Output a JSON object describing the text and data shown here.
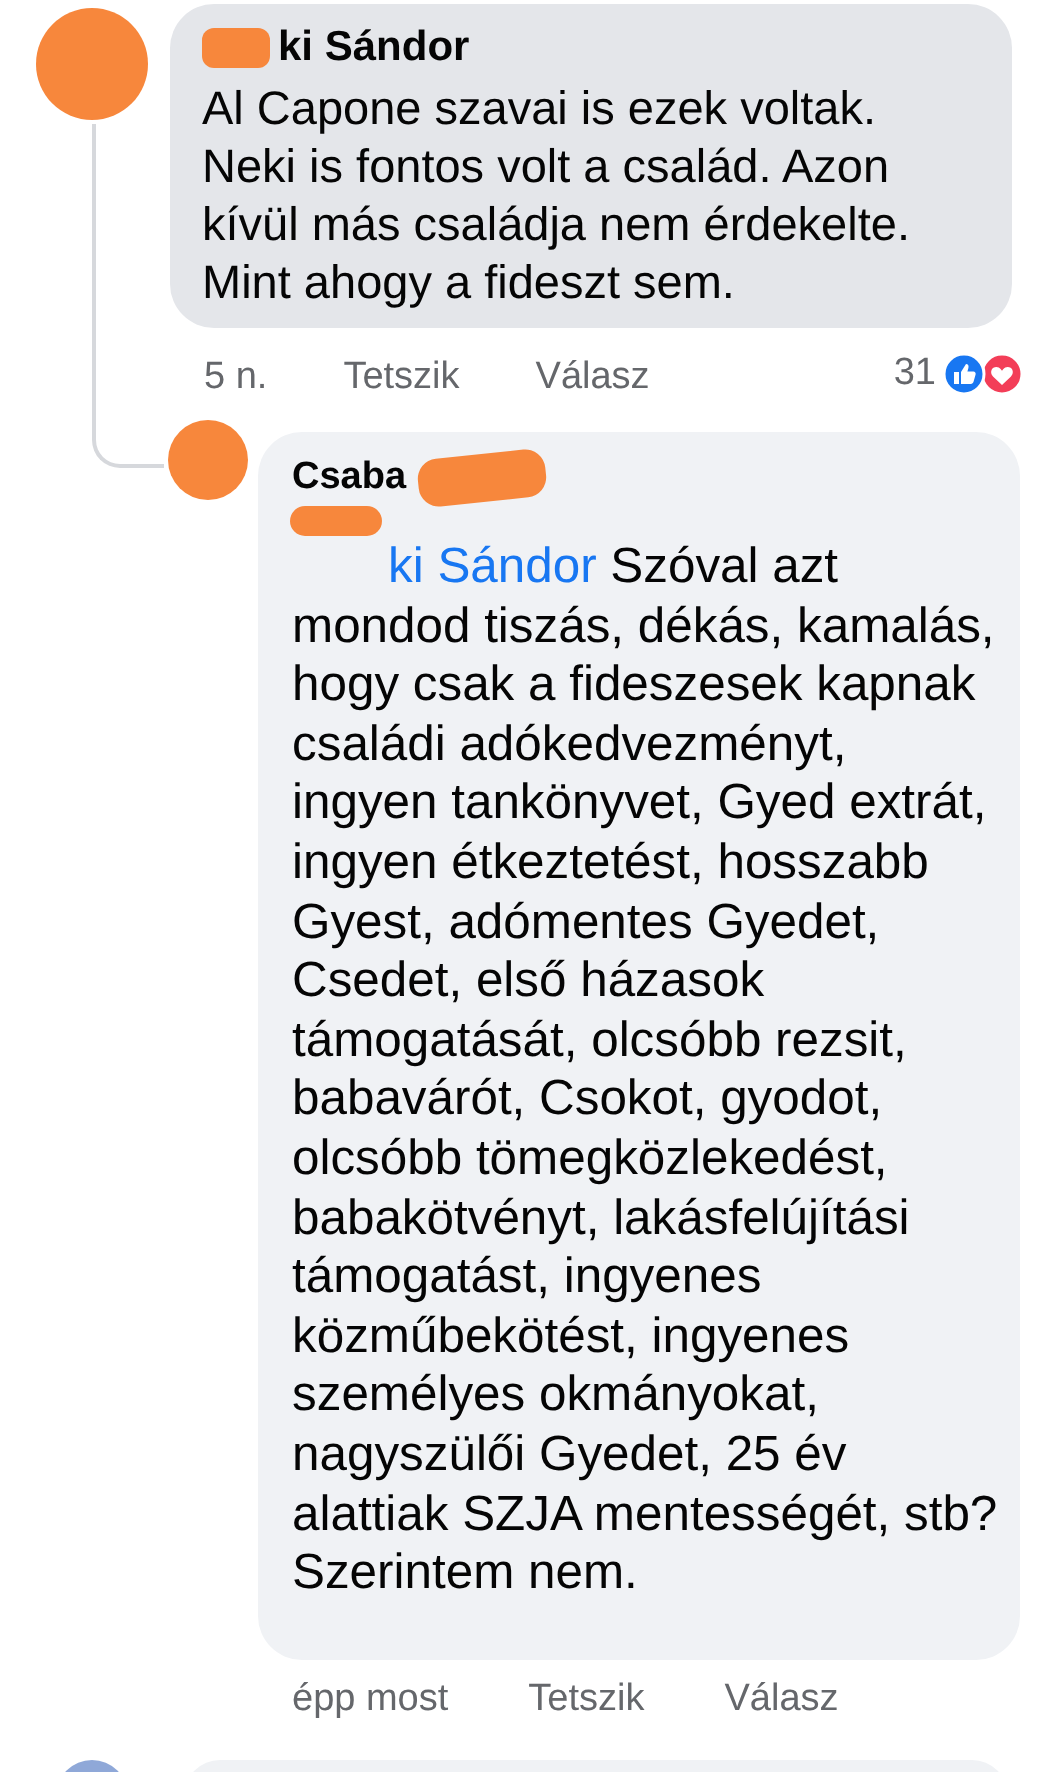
{
  "comments": [
    {
      "author": "ki Sándor",
      "body": "Al Capone szavai is ezek voltak. Neki is fontos volt a család. Azon kívül más családja nem érdekelte. Mint ahogy a fideszt sem.",
      "time": "5 n.",
      "actions": [
        "Tetszik",
        "Válasz"
      ],
      "reaction_count": "31"
    },
    {
      "author": "Csaba",
      "mention": "ki Sándor",
      "body": "Szóval azt mondod tiszás, dékás, kamalás, hogy csak a fideszesek kapnak családi adókedvezményt, ingyen tankönyvet, Gyed extrát, ingyen étkeztetést, hosszabb Gyest, adómentes Gyedet, Csedet, első házasok támogatását, olcsóbb rezsit, babavárót, Csokot, gyodot, olcsóbb tömegközlekedést, babakötvényt, lakásfelújítási támogatást, ingyenes közműbekötést, ingyenes személyes okmányokat, nagyszülői Gyedet, 25 év alattiak SZJA mentességét, stb? Szerintem nem.",
      "time": "épp most",
      "actions": [
        "Tetszik",
        "Válasz"
      ]
    }
  ]
}
